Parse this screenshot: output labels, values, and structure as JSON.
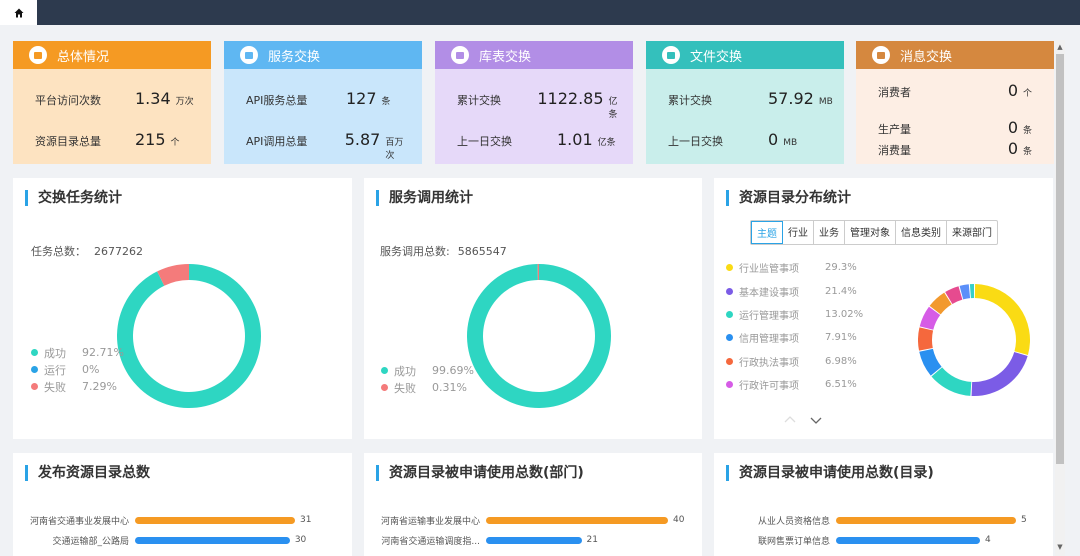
{
  "cards": [
    {
      "title": "总体情况",
      "head": "#f59a23",
      "bg": "#fde3c1",
      "icon": "monitor-icon",
      "rows": [
        {
          "label": "平台访问次数",
          "value": "1.34",
          "unit": "万次"
        },
        {
          "label": "资源目录总量",
          "value": "215",
          "unit": "个"
        }
      ]
    },
    {
      "title": "服务交换",
      "head": "#5fb7f2",
      "bg": "#c9e6fb",
      "icon": "cloud-icon",
      "rows": [
        {
          "label": "API服务总量",
          "value": "127",
          "unit": "条"
        },
        {
          "label": "API调用总量",
          "value": "5.87",
          "unit": "百万次"
        }
      ]
    },
    {
      "title": "库表交换",
      "head": "#b28ee6",
      "bg": "#e6d9f9",
      "icon": "database-icon",
      "rows": [
        {
          "label": "累计交换",
          "value": "1122.85",
          "unit": "亿条"
        },
        {
          "label": "上一日交换",
          "value": "1.01",
          "unit": "亿条"
        }
      ]
    },
    {
      "title": "文件交换",
      "head": "#34c0bc",
      "bg": "#c9eeeb",
      "icon": "file-icon",
      "rows": [
        {
          "label": "累计交换",
          "value": "57.92",
          "unit": "MB"
        },
        {
          "label": "上一日交换",
          "value": "0",
          "unit": "MB"
        }
      ]
    },
    {
      "title": "消息交换",
      "head": "#d5883f",
      "bg": "#fdeee4",
      "icon": "message-icon",
      "rows": [
        {
          "label": "消费者",
          "value": "0",
          "unit": "个"
        },
        {
          "label": "生产量",
          "value": "0",
          "unit": "条"
        },
        {
          "label": "消费量",
          "value": "0",
          "unit": "条"
        }
      ]
    }
  ],
  "exchange_task": {
    "title": "交换任务统计",
    "total_label": "任务总数：",
    "total": "2677262",
    "legend": [
      {
        "name": "成功",
        "pct": "92.71%",
        "color": "#2ed6c2"
      },
      {
        "name": "运行",
        "pct": "0%",
        "color": "#2aa3e6"
      },
      {
        "name": "失败",
        "pct": "7.29%",
        "color": "#f47b7b"
      }
    ]
  },
  "service_call": {
    "title": "服务调用统计",
    "total_label": "服务调用总数:",
    "total": "5865547",
    "legend": [
      {
        "name": "成功",
        "pct": "99.69%",
        "color": "#2ed6c2"
      },
      {
        "name": "失败",
        "pct": "0.31%",
        "color": "#f47b7b"
      }
    ]
  },
  "resource_dist": {
    "title": "资源目录分布统计",
    "tabs": [
      "主题",
      "行业",
      "业务",
      "管理对象",
      "信息类别",
      "来源部门"
    ],
    "active_tab": "主题",
    "legend": [
      {
        "name": "行业监管事项",
        "pct": "29.3%",
        "color": "#fadb14"
      },
      {
        "name": "基本建设事项",
        "pct": "21.4%",
        "color": "#7b5ce6"
      },
      {
        "name": "运行管理事项",
        "pct": "13.02%",
        "color": "#2ed6c2"
      },
      {
        "name": "信用管理事项",
        "pct": "7.91%",
        "color": "#2a90f0"
      },
      {
        "name": "行政执法事项",
        "pct": "6.98%",
        "color": "#f5683d"
      },
      {
        "name": "行政许可事项",
        "pct": "6.51%",
        "color": "#d65ce6"
      }
    ],
    "extra_colors": [
      "#f2992e",
      "#e64b8f",
      "#5b8ff9",
      "#36cfc9"
    ]
  },
  "chart_data": [
    {
      "type": "pie",
      "title": "交换任务统计",
      "labels": [
        "成功",
        "运行",
        "失败"
      ],
      "values": [
        92.71,
        0,
        7.29
      ]
    },
    {
      "type": "pie",
      "title": "服务调用统计",
      "labels": [
        "成功",
        "失败"
      ],
      "values": [
        99.69,
        0.31
      ]
    },
    {
      "type": "pie",
      "title": "资源目录分布统计",
      "labels": [
        "行业监管事项",
        "基本建设事项",
        "运行管理事项",
        "信用管理事项",
        "行政执法事项",
        "行政许可事项"
      ],
      "values": [
        29.3,
        21.4,
        13.02,
        7.91,
        6.98,
        6.51
      ]
    },
    {
      "type": "bar",
      "title": "发布资源目录总数",
      "categories": [
        "河南省交通事业发展中心",
        "交通运输部_公路局"
      ],
      "values": [
        31,
        30
      ]
    },
    {
      "type": "bar",
      "title": "资源目录被申请使用总数(部门)",
      "categories": [
        "河南省运输事业发展中心",
        "河南省交通运输调度指..."
      ],
      "values": [
        40,
        21
      ]
    },
    {
      "type": "bar",
      "title": "资源目录被申请使用总数(目录)",
      "categories": [
        "从业人员资格信息",
        "联网售票订单信息"
      ],
      "values": [
        5,
        4
      ]
    }
  ],
  "bar_panels": [
    {
      "title": "发布资源目录总数",
      "max": 31,
      "rows": [
        {
          "label": "河南省交通事业发展中心",
          "value": 31,
          "color": "#f59a23"
        },
        {
          "label": "交通运输部_公路局",
          "value": 30,
          "color": "#2a90f0"
        }
      ]
    },
    {
      "title": "资源目录被申请使用总数(部门)",
      "max": 40,
      "rows": [
        {
          "label": "河南省运输事业发展中心",
          "value": 40,
          "color": "#f59a23"
        },
        {
          "label": "河南省交通运输调度指...",
          "value": 21,
          "color": "#2a90f0"
        }
      ]
    },
    {
      "title": "资源目录被申请使用总数(目录)",
      "max": 5,
      "rows": [
        {
          "label": "从业人员资格信息",
          "value": 5,
          "color": "#f59a23"
        },
        {
          "label": "联网售票订单信息",
          "value": 4,
          "color": "#2a90f0"
        }
      ]
    }
  ]
}
